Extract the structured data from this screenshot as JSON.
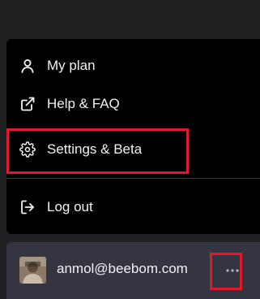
{
  "menu": {
    "items": [
      {
        "label": "My plan",
        "icon": "user-icon"
      },
      {
        "label": "Help & FAQ",
        "icon": "external-link-icon"
      },
      {
        "label": "Settings & Beta",
        "icon": "gear-icon"
      },
      {
        "label": "Log out",
        "icon": "logout-icon"
      }
    ]
  },
  "user": {
    "email": "anmol@beebom.com",
    "avatar_icon": "avatar-photo",
    "more_icon": "more-horizontal-icon"
  },
  "colors": {
    "background": "#202123",
    "menu_background": "#000000",
    "user_bar_background": "#343541",
    "highlight": "#e0192c",
    "text": "#f2f2f2"
  }
}
